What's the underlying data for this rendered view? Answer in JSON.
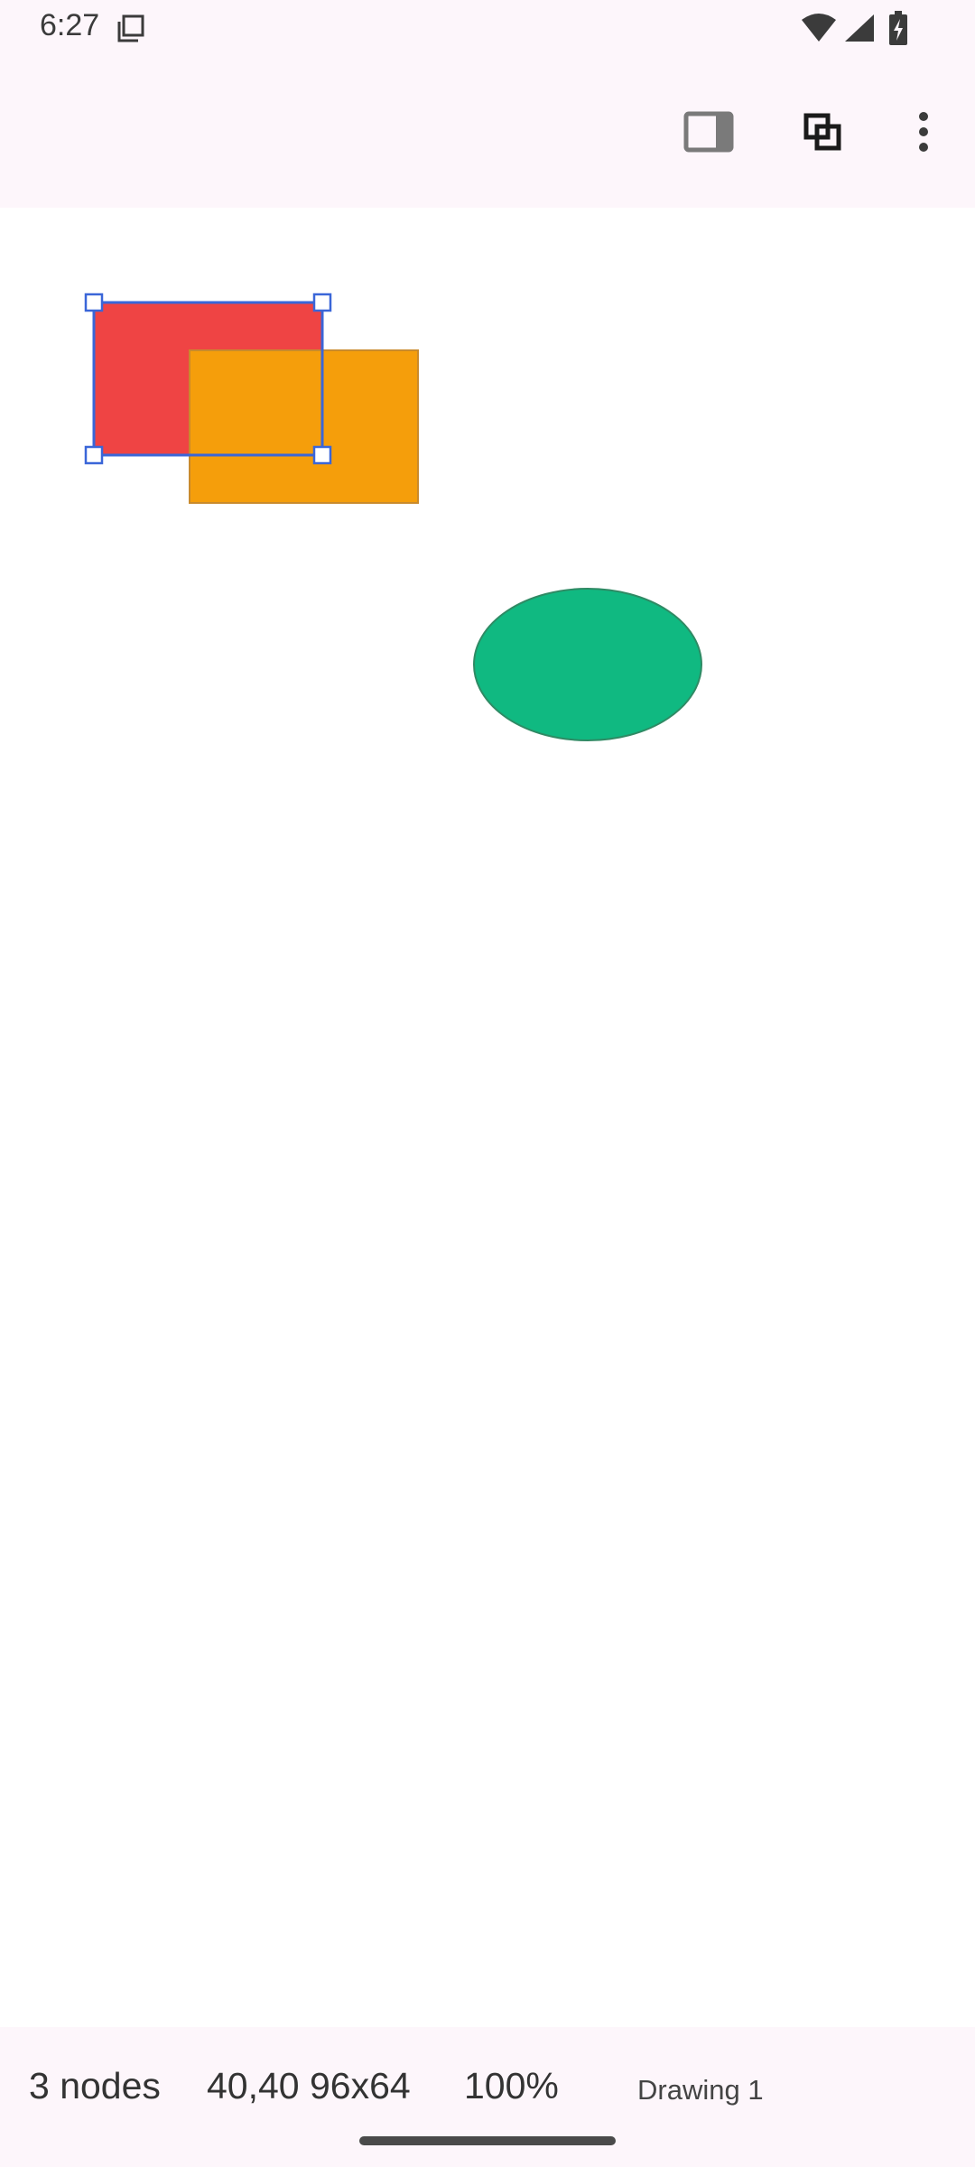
{
  "status_bar": {
    "time": "6:27",
    "icons": [
      "copy-notification-icon",
      "wifi-icon",
      "cellular-signal-icon",
      "battery-charging-icon"
    ]
  },
  "toolbar": {
    "actions": [
      {
        "name": "panel-toggle-icon"
      },
      {
        "name": "group-objects-icon"
      },
      {
        "name": "more-options-icon"
      }
    ]
  },
  "canvas": {
    "selection_color": "#3a66d8",
    "shapes": [
      {
        "kind": "rectangle",
        "fill": "#ef4444",
        "stroke": "#3a66d8",
        "selected": true
      },
      {
        "kind": "rectangle",
        "fill": "#f59e0b",
        "stroke": "#c98a2c",
        "selected": false
      },
      {
        "kind": "ellipse",
        "fill": "#10b981",
        "stroke": "#2f8a64",
        "selected": false
      }
    ]
  },
  "info_bar": {
    "nodes": "3 nodes",
    "selection_geometry": "40,40 96x64",
    "zoom": "100%",
    "document_name": "Drawing 1"
  }
}
